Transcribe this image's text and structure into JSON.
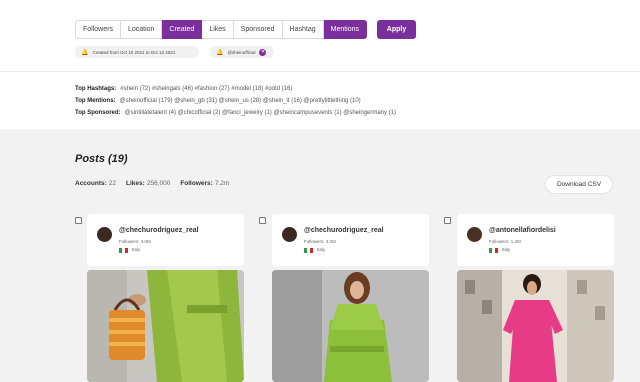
{
  "filters": [
    "Followers",
    "Location",
    "Created",
    "Likes",
    "Sponsored",
    "Hashtag",
    "Mentions"
  ],
  "apply_label": "Apply",
  "chips": {
    "date": "Created from Oct 10 2021 to Oct 13 2021",
    "mention": "@sheinofficial"
  },
  "tops": {
    "hashtags_label": "Top Hashtags:",
    "hashtags_value": "#shein (72)  #sheingals (46)  #fashion (27)  #model (18)  #ootd (16)",
    "mentions_label": "Top Mentions:",
    "mentions_value": "@sheinofficial (179)  @shein_gb (31)  @shein_us (28)  @shein_it (16)  @prettylittlething (10)",
    "sponsored_label": "Top Sponsored:",
    "sponsored_value": "@sintillatetalent (4)  @chicofficial (2)  @fanci_jewelry (1)  @sheincampusevents (1)  @sheingermany (1)"
  },
  "posts": {
    "title": "Posts (19)",
    "accounts_label": "Accounts:",
    "accounts_value": "22",
    "likes_label": "Likes:",
    "likes_value": "256,000",
    "followers_label": "Followers:",
    "followers_value": "7.2m",
    "download_label": "Download CSV"
  },
  "cards": [
    {
      "username": "@chechurodriguez_real",
      "followers": "Followers: 4.0M",
      "country": "Italy"
    },
    {
      "username": "@chechurodriguez_real",
      "followers": "Followers: 4.0M",
      "country": "Italy"
    },
    {
      "username": "@antonellafiordelisi",
      "followers": "Followers: 1.2M",
      "country": "Italy"
    }
  ],
  "colors": {
    "accent": "#7b2f9c",
    "background_gray": "#f2f2f2"
  },
  "icons": [
    "bell-icon",
    "close-icon",
    "checkbox-icon"
  ]
}
